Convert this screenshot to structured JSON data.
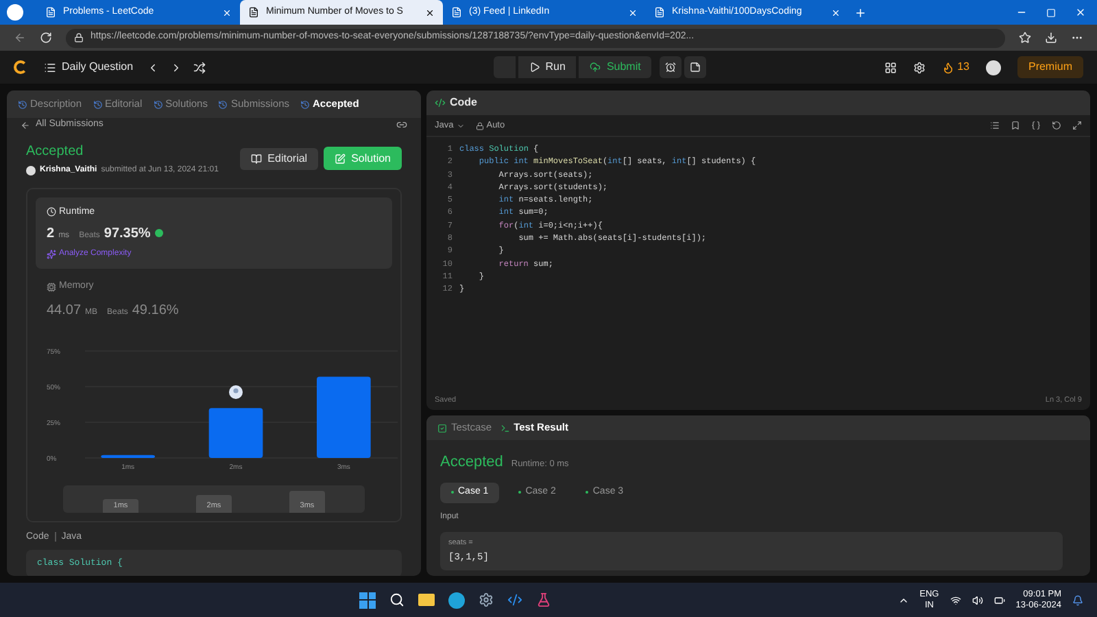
{
  "browser": {
    "tabs": [
      {
        "title": "Problems - LeetCode",
        "selected": false
      },
      {
        "title": "Minimum Number of Moves to S",
        "selected": true
      },
      {
        "title": "(3) Feed | LinkedIn",
        "selected": false
      },
      {
        "title": "Krishna-Vaithi/100DaysCoding",
        "selected": false
      }
    ],
    "url": "https://leetcode.com/problems/minimum-number-of-moves-to-seat-everyone/submissions/1287188735/?envType=daily-question&envId=202..."
  },
  "nav": {
    "title": "Daily Question",
    "run": "Run",
    "submit": "Submit",
    "streak": "13",
    "premium": "Premium"
  },
  "left": {
    "tabs": [
      {
        "label": "Description",
        "selected": false
      },
      {
        "label": "Editorial",
        "selected": false
      },
      {
        "label": "Solutions",
        "selected": false
      },
      {
        "label": "Submissions",
        "selected": false
      },
      {
        "label": "Accepted",
        "selected": true
      }
    ],
    "back": "All Submissions",
    "status": "Accepted",
    "user": "Krishna_Vaithi",
    "submitted": "submitted at Jun 13, 2024 21:01",
    "editorial": "Editorial",
    "solution": "Solution",
    "runtime": {
      "title": "Runtime",
      "value": "2",
      "unit": "ms",
      "beats_label": "Beats",
      "beats": "97.35%",
      "analyze": "Analyze Complexity"
    },
    "memory": {
      "title": "Memory",
      "value": "44.07",
      "unit": "MB",
      "beats_label": "Beats",
      "beats": "49.16%"
    },
    "chart_data": {
      "type": "bar",
      "categories": [
        "1ms",
        "2ms",
        "3ms"
      ],
      "values": [
        2,
        35,
        57
      ],
      "ylim": [
        0,
        75
      ],
      "yticks": [
        {
          "value": 0,
          "label": "0%"
        },
        {
          "value": 25,
          "label": "25%"
        },
        {
          "value": 50,
          "label": "50%"
        },
        {
          "value": 75,
          "label": "75%"
        }
      ]
    },
    "range_labels": [
      "1ms",
      "2ms",
      "3ms"
    ],
    "code_label": "Code",
    "code_lang": "Java",
    "code_preview": "class Solution {"
  },
  "editor": {
    "title": "Code",
    "language": "Java",
    "mode": "Auto",
    "status": "Saved",
    "cursor": "Ln 3, Col 9",
    "lines": [
      {
        "n": "1",
        "tokens": [
          {
            "kind": "keyword",
            "text": "class "
          },
          {
            "kind": "type",
            "text": "Solution "
          },
          {
            "kind": "plain",
            "text": "{"
          }
        ]
      },
      {
        "n": "2",
        "tokens": [
          {
            "kind": "keyword",
            "text": "    public int "
          },
          {
            "kind": "function",
            "text": "minMovesToSeat"
          },
          {
            "kind": "plain",
            "text": "("
          },
          {
            "kind": "keyword",
            "text": "int"
          },
          {
            "kind": "plain",
            "text": "[] seats, "
          },
          {
            "kind": "keyword",
            "text": "int"
          },
          {
            "kind": "plain",
            "text": "[] students) {"
          }
        ]
      },
      {
        "n": "3",
        "tokens": [
          {
            "kind": "plain",
            "text": "        Arrays.sort(seats);"
          }
        ]
      },
      {
        "n": "4",
        "tokens": [
          {
            "kind": "plain",
            "text": "        Arrays.sort(students);"
          }
        ]
      },
      {
        "n": "5",
        "tokens": [
          {
            "kind": "keyword",
            "text": "        int "
          },
          {
            "kind": "plain",
            "text": "n=seats.length;"
          }
        ]
      },
      {
        "n": "6",
        "tokens": [
          {
            "kind": "keyword",
            "text": "        int "
          },
          {
            "kind": "plain",
            "text": "sum=0;"
          }
        ]
      },
      {
        "n": "7",
        "tokens": [
          {
            "kind": "control",
            "text": "        for"
          },
          {
            "kind": "plain",
            "text": "("
          },
          {
            "kind": "keyword",
            "text": "int "
          },
          {
            "kind": "plain",
            "text": "i=0;i<n;i++){"
          }
        ]
      },
      {
        "n": "8",
        "tokens": [
          {
            "kind": "plain",
            "text": "            sum += Math.abs(seats[i]-students[i]);"
          }
        ]
      },
      {
        "n": "9",
        "tokens": [
          {
            "kind": "plain",
            "text": "        }"
          }
        ]
      },
      {
        "n": "10",
        "tokens": [
          {
            "kind": "control",
            "text": "        return "
          },
          {
            "kind": "plain",
            "text": "sum;"
          }
        ]
      },
      {
        "n": "11",
        "tokens": [
          {
            "kind": "plain",
            "text": "    }"
          }
        ]
      },
      {
        "n": "12",
        "tokens": [
          {
            "kind": "plain",
            "text": "}"
          }
        ]
      }
    ]
  },
  "result": {
    "tabs": [
      {
        "label": "Testcase",
        "selected": false
      },
      {
        "label": "Test Result",
        "selected": true
      }
    ],
    "status": "Accepted",
    "runtime": "Runtime: 0 ms",
    "cases": [
      {
        "label": "Case 1",
        "selected": true
      },
      {
        "label": "Case 2",
        "selected": false
      },
      {
        "label": "Case 3",
        "selected": false
      }
    ],
    "input_label": "Input",
    "var": "seats =",
    "value": "[3,1,5]"
  },
  "taskbar": {
    "lang": "ENG",
    "region": "IN",
    "time": "09:01 PM",
    "date": "13-06-2024"
  }
}
